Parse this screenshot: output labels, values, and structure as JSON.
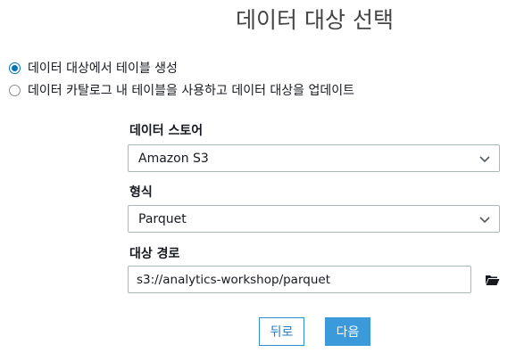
{
  "page": {
    "title": "데이터 대상 선택"
  },
  "options": [
    {
      "label": "데이터 대상에서 테이블 생성",
      "checked": true
    },
    {
      "label": "데이터 카탈로그 내 테이블을 사용하고 데이터 대상을 업데이트",
      "checked": false
    }
  ],
  "form": {
    "data_store": {
      "label": "데이터 스토어",
      "value": "Amazon S3",
      "icon": "chevron-down-icon"
    },
    "format": {
      "label": "형식",
      "value": "Parquet",
      "icon": "chevron-down-icon"
    },
    "target_path": {
      "label": "대상 경로",
      "value": "s3://analytics-workshop/parquet",
      "icon": "folder-open-icon"
    }
  },
  "buttons": {
    "back": "뒤로",
    "next": "다음"
  },
  "colors": {
    "accent": "#0073bb",
    "primary_button": "#3b9ad9",
    "border": "#aab7b8"
  }
}
